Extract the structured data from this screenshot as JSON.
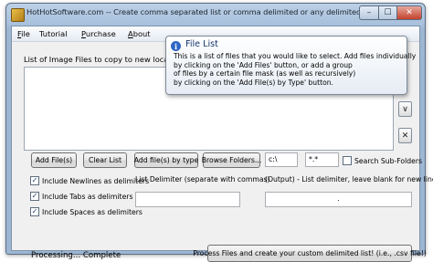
{
  "window": {
    "title": "HotHotSoftware.com -- Create comma separated list or comma delimited or any delimited file Software",
    "min_glyph": "–",
    "max_glyph": "☐",
    "close_glyph": "✕"
  },
  "menu": [
    {
      "key": "F",
      "rest": "ile"
    },
    {
      "key": "",
      "rest": "Tutorial"
    },
    {
      "key": "P",
      "rest": "urchase"
    },
    {
      "key": "A",
      "rest": "bout"
    }
  ],
  "list": {
    "label": "List of Image Files to copy to new locatio",
    "down_arrow": "∨",
    "remove": "✕"
  },
  "buttons": {
    "add_files": "Add File(s)",
    "clear_list": "Clear List",
    "add_by_type": "Add file(s) by type",
    "browse_folders": "Browse Folders..."
  },
  "inputs": {
    "path": "c:\\",
    "mask": "*.*",
    "list_delimiter": "",
    "output_delimiter": "."
  },
  "checkboxes": {
    "search_subfolders": {
      "label": "Search Sub-Folders",
      "checked": false
    },
    "include_newlines": {
      "label": "Include Newlines as delimiters",
      "checked": true
    },
    "include_tabs": {
      "label": "Include Tabs as delimiters",
      "checked": true
    },
    "include_spaces": {
      "label": "Include Spaces as delimiters",
      "checked": true
    }
  },
  "labels": {
    "list_delimiter": "List Delimiter (separate with commas)",
    "output_delimiter": "(Output) - List delimiter, leave blank for new line"
  },
  "status": "Processing... Complete",
  "process_button": "Process Files and create your custom delimited list! (i.e., .csv file!)",
  "tooltip": {
    "title": "File List",
    "body": "This is a list of files that you would like to select. Add files individually\nby clicking on the 'Add Files' button, or add a group\nof files by a certain file mask (as well as recursively)\nby clicking on the 'Add File(s) by Type' button."
  },
  "colors": {
    "titlebar": "#a9c1dc",
    "client_bg": "#f0f0f0",
    "tooltip_title": "#17386f"
  }
}
